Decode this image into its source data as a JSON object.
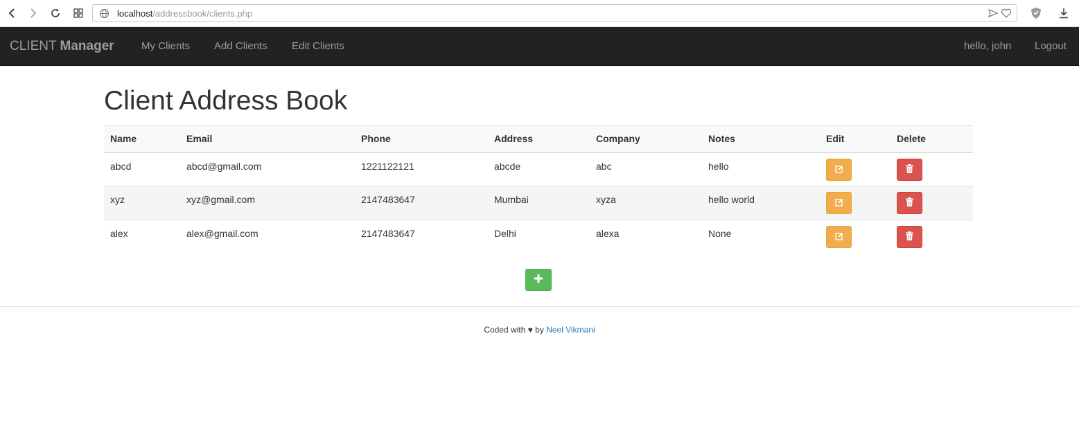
{
  "browser": {
    "url_host": "localhost",
    "url_path": "/addressbook/clients.php"
  },
  "navbar": {
    "brand_light": "CLIENT",
    "brand_bold": "Manager",
    "links": [
      "My Clients",
      "Add Clients",
      "Edit Clients"
    ],
    "greeting": "hello, john",
    "logout": "Logout"
  },
  "page": {
    "title": "Client Address Book"
  },
  "table": {
    "headers": [
      "Name",
      "Email",
      "Phone",
      "Address",
      "Company",
      "Notes",
      "Edit",
      "Delete"
    ],
    "rows": [
      {
        "name": "abcd",
        "email": "abcd@gmail.com",
        "phone": "1221122121",
        "address": "abcde",
        "company": "abc",
        "notes": "hello"
      },
      {
        "name": "xyz",
        "email": "xyz@gmail.com",
        "phone": "2147483647",
        "address": "Mumbai",
        "company": "xyza",
        "notes": "hello world"
      },
      {
        "name": "alex",
        "email": "alex@gmail.com",
        "phone": "2147483647",
        "address": "Delhi",
        "company": "alexa",
        "notes": "None"
      }
    ]
  },
  "footer": {
    "prefix": "Coded with ♥ by",
    "author": "Neel Vikmani"
  },
  "colors": {
    "navbar_bg": "#222222",
    "edit_button": "#f0ad4e",
    "delete_button": "#d9534f",
    "add_button": "#5cb85c",
    "link": "#337ab7"
  },
  "icons": {
    "back": "back-arrow-icon",
    "forward": "forward-arrow-icon",
    "reload": "reload-icon",
    "tabs": "grid-icon",
    "site": "globe-icon",
    "send": "send-icon",
    "bookmark": "heart-icon",
    "shield": "shield-icon",
    "download": "download-icon",
    "edit": "edit-icon",
    "delete": "trash-icon",
    "add": "plus-icon"
  }
}
